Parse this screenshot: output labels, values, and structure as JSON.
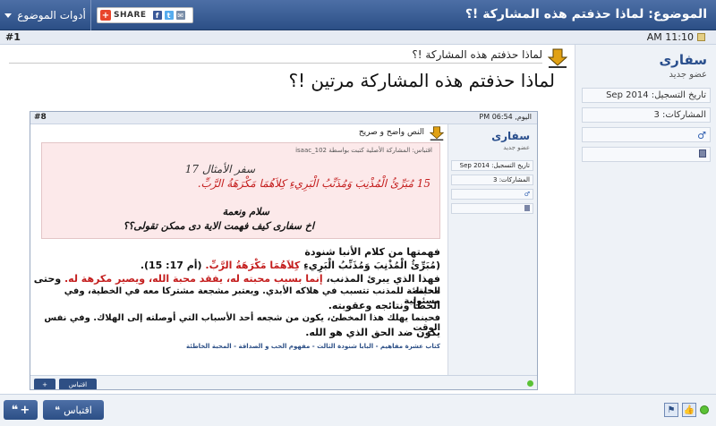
{
  "thread": {
    "title": "الموضوع: لماذا حذفتم هذه المشاركة !؟",
    "tools_label": "أدوات الموضوع",
    "share_label": "SHARE"
  },
  "post": {
    "number": "#1",
    "date": "AM 11:10",
    "subject": "لماذا حذفتم هذه المشاركة !؟",
    "message": "لماذا حذفتم هذه المشاركة مرتين !؟"
  },
  "author": {
    "username": "سفارى",
    "title": "عضو جديد",
    "join_date": "تاريخ التسجيل: Sep 2014",
    "posts": "المشاركات: 3"
  },
  "embedded": {
    "number": "#8",
    "date": "اليوم, PM 06:54",
    "subject": "النص واضح و صريح",
    "username": "سفارى",
    "title": "عضو جديد",
    "join_date": "تاريخ التسجيل: Sep 2014",
    "posts": "المشاركات: 3",
    "quote_by": "اقتباس: المشاركة الأصلية كتبت بواسطة isaac_102",
    "quote_line1": "سفر الأمثال 17",
    "quote_line2": "15 مُبَرِّئُ الْمُذْنِبَ وَمُذَنِّبُ الْبَرِيءِ كِلاَهُمَا مَكْرَهَةُ الرَّبِّ.",
    "quote_line3": "سلام ونعمة",
    "quote_line4": "اخ سفارى كيف فهمت الاية دى ممكن تقولى؟؟",
    "body_line1": "فهمتها من كلام الأنبا شنودة",
    "body_line2a": "(مُبَرِّئُ الْمُذْنِبَ وَمُذَنِّبُ الْبَرِيءِ",
    "body_line2b": " كِلاَهُمَا مَكْرَهَةُ الرَّبِّ.",
    "body_line2c": " (أم 17: 15).",
    "body_line3a": "فهذا الذي يبرئ المذنب، ",
    "body_line3b": "إنما بسبب محبته له، يفقد محبة الله، ويصير مكرهة له.",
    "body_line3c": " وحتى محبته",
    "body_line4": "الخاطئة للمذنب تتسبب في هلاكه الأبدي. ويعتبر مشجعة مشتركا معه في الخطية، وفي مسئولية",
    "body_line5": "الخطأ ونتائجه وعقوبته.",
    "body_line6": "فحينما يهلك هذا المخطئ، يكون من شجعه أحد الأسباب التي أوصلته إلى الهلاك. وفي نفس الوقت",
    "body_line7": "يكون ضد الحق الذي هو الله.",
    "source": "كتاب عشرة مفاهيم - البابا شنودة الثالث - مفهوم الحب و الصداقة - المحبة الخاطئة",
    "quote_label": "اقتباس",
    "mq_label": "+"
  },
  "actions": {
    "quote_label": "اقتباس",
    "quote_icon": "❝",
    "multiquote_label": "+"
  },
  "colors": {
    "header": "#2c4f86",
    "accent_red": "#c41e1e",
    "quote_bg": "#fce9ea"
  }
}
